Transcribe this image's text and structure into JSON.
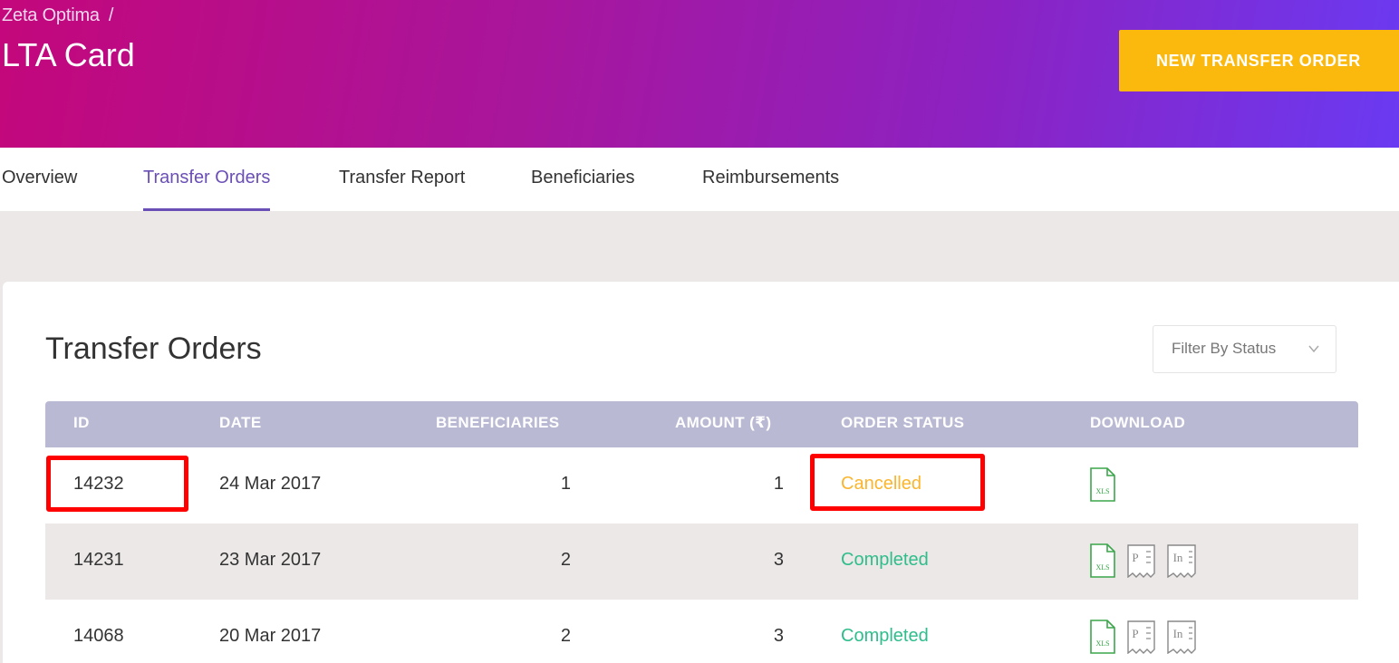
{
  "header": {
    "breadcrumb": "Zeta Optima",
    "breadcrumb_separator": "/",
    "title": "LTA Card",
    "cta_label": "NEW TRANSFER ORDER"
  },
  "tabs": [
    {
      "label": "Overview",
      "active": false
    },
    {
      "label": "Transfer Orders",
      "active": true
    },
    {
      "label": "Transfer Report",
      "active": false
    },
    {
      "label": "Beneficiaries",
      "active": false
    },
    {
      "label": "Reimbursements",
      "active": false
    }
  ],
  "section": {
    "title": "Transfer Orders",
    "filter_placeholder": "Filter By Status"
  },
  "table": {
    "columns": [
      "ID",
      "DATE",
      "BENEFICIARIES",
      "AMOUNT (₹)",
      "ORDER STATUS",
      "DOWNLOAD"
    ],
    "rows": [
      {
        "id": "14232",
        "date": "24 Mar 2017",
        "beneficiaries": "1",
        "amount": "1",
        "status": "Cancelled",
        "downloads": [
          "xls-icon"
        ],
        "highlighted": true
      },
      {
        "id": "14231",
        "date": "23 Mar 2017",
        "beneficiaries": "2",
        "amount": "3",
        "status": "Completed",
        "downloads": [
          "xls-icon",
          "pdf-icon",
          "invoice-icon"
        ],
        "highlighted": false
      },
      {
        "id": "14068",
        "date": "20 Mar 2017",
        "beneficiaries": "2",
        "amount": "3",
        "status": "Completed",
        "downloads": [
          "xls-icon",
          "pdf-icon",
          "invoice-icon"
        ],
        "highlighted": false
      }
    ]
  },
  "icon_text": {
    "xls": "XLS",
    "pdf": "P",
    "invoice": "In"
  },
  "colors": {
    "gradient_start": "#c4077b",
    "gradient_end": "#6a3af2",
    "cta": "#fbb80d",
    "active_tab": "#6a4fb6",
    "table_header": "#b9b9d4",
    "status_cancelled": "#fbb52e",
    "status_completed": "#2ebd8b",
    "highlight": "#ff0000"
  }
}
